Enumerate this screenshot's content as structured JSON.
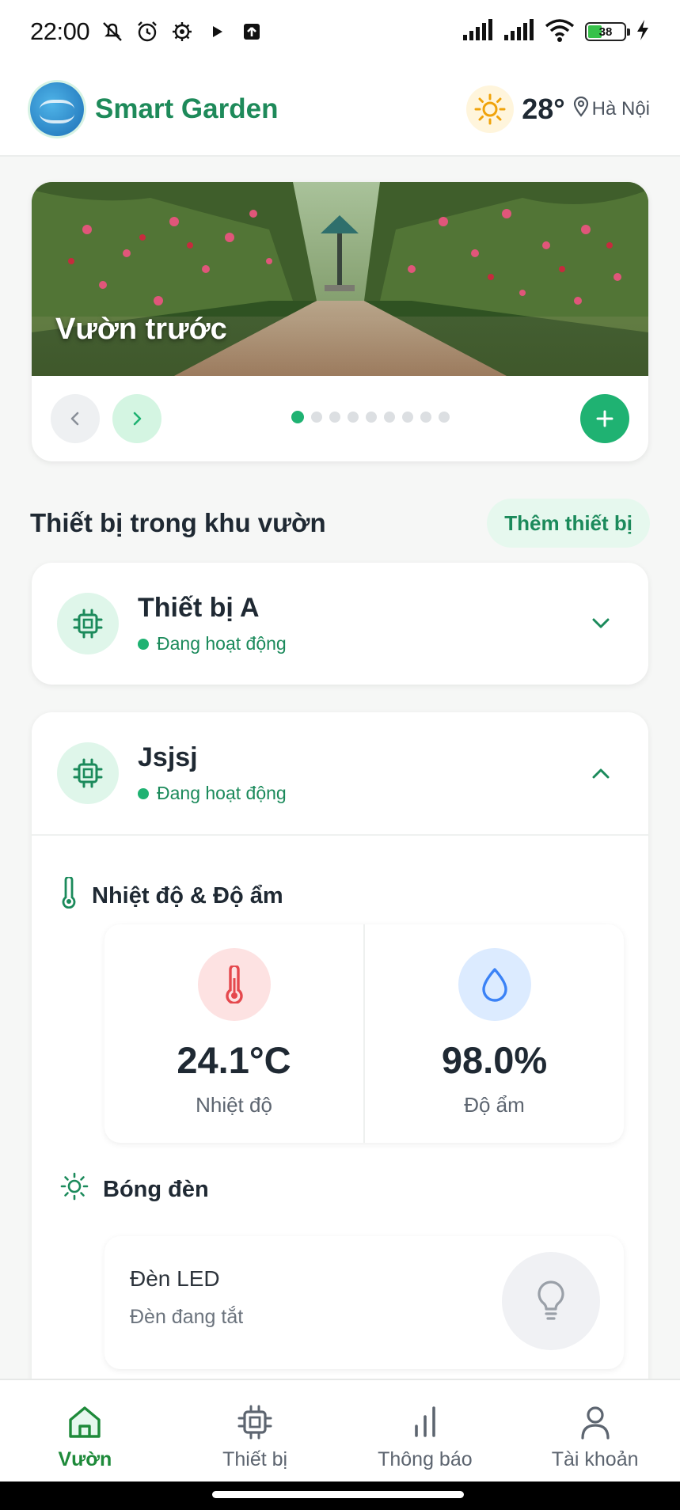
{
  "status_bar": {
    "time": "22:00",
    "battery": "38",
    "icons": [
      "mute-icon",
      "alarm-icon",
      "settings-icon",
      "play-icon",
      "upload-icon",
      "signal-icon",
      "signal-icon",
      "wifi-icon",
      "battery-icon",
      "charging-icon"
    ]
  },
  "header": {
    "app_name": "Smart Garden",
    "temperature": "28°",
    "location": "Hà Nội"
  },
  "garden": {
    "name": "Vườn trước",
    "page_count": 9,
    "active_index": 0
  },
  "devices_section": {
    "title": "Thiết bị trong khu vườn",
    "add_label": "Thêm thiết bị"
  },
  "devices": [
    {
      "name": "Thiết bị A",
      "status": "Đang hoạt động",
      "expanded": false
    },
    {
      "name": "Jsjsj",
      "status": "Đang hoạt động",
      "expanded": true,
      "climate": {
        "title": "Nhiệt độ & Độ ẩm",
        "temperature": "24.1°C",
        "temperature_label": "Nhiệt độ",
        "humidity": "98.0%",
        "humidity_label": "Độ ẩm"
      },
      "lights": {
        "title": "Bóng đèn",
        "lamp_name": "Đèn LED",
        "lamp_state": "Đèn đang tắt"
      }
    }
  ],
  "nav": [
    {
      "label": "Vườn",
      "icon": "home-icon",
      "active": true
    },
    {
      "label": "Thiết bị",
      "icon": "chip-icon",
      "active": false
    },
    {
      "label": "Thông báo",
      "icon": "bar-chart-icon",
      "active": false
    },
    {
      "label": "Tài khoản",
      "icon": "user-icon",
      "active": false
    }
  ],
  "colors": {
    "accent": "#1fb272",
    "accent_dark": "#1b8a5b",
    "temp_red": "#e5484d",
    "humid_blue": "#3b82f6"
  }
}
